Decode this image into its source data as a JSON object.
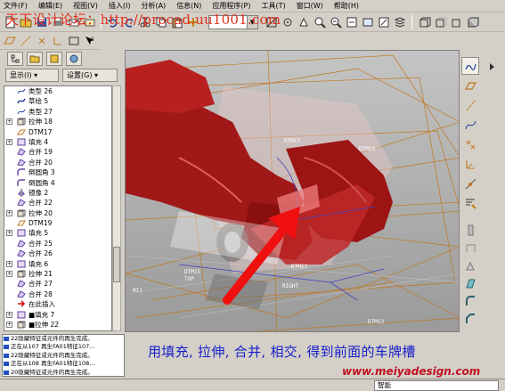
{
  "menu": {
    "items": [
      "文件(F)",
      "编辑(E)",
      "视图(V)",
      "插入(I)",
      "分析(A)",
      "信息(N)",
      "应用程序(P)",
      "工具(T)",
      "窗口(W)",
      "帮助(H)"
    ]
  },
  "watermark": "天下设计论坛：http://procad.uu1001.com",
  "left_panel": {
    "buttons": [
      "显示(I)",
      "设置(G)"
    ],
    "tree_items": [
      {
        "label": "类型 26",
        "icon": "curve-icon"
      },
      {
        "label": "草绘 5",
        "icon": "sketch-icon"
      },
      {
        "label": "类型 27",
        "icon": "curve-icon"
      },
      {
        "label": "拉伸 18",
        "icon": "extrude-icon",
        "expandable": true
      },
      {
        "label": "DTM17",
        "icon": "datum-plane-icon"
      },
      {
        "label": "填充 4",
        "icon": "fill-icon",
        "expandable": true
      },
      {
        "label": "合并 19",
        "icon": "merge-icon"
      },
      {
        "label": "合并 20",
        "icon": "merge-icon"
      },
      {
        "label": "倒圆角 3",
        "icon": "round-icon"
      },
      {
        "label": "倒圆角 4",
        "icon": "round-icon"
      },
      {
        "label": "镜像 2",
        "icon": "mirror-icon"
      },
      {
        "label": "合并 22",
        "icon": "merge-icon"
      },
      {
        "label": "拉伸 20",
        "icon": "extrude-icon",
        "expandable": true
      },
      {
        "label": "DTM19",
        "icon": "datum-plane-icon"
      },
      {
        "label": "填充 5",
        "icon": "fill-icon",
        "expandable": true
      },
      {
        "label": "合并 25",
        "icon": "merge-icon"
      },
      {
        "label": "合并 26",
        "icon": "merge-icon"
      },
      {
        "label": "填充 6",
        "icon": "fill-icon",
        "expandable": true
      },
      {
        "label": "拉伸 21",
        "icon": "extrude-icon",
        "expandable": true
      },
      {
        "label": "合并 27",
        "icon": "merge-icon"
      },
      {
        "label": "合并 28",
        "icon": "merge-icon"
      },
      {
        "label": "在此插入",
        "icon": "insert-here-icon"
      },
      {
        "label": "■填充 7",
        "icon": "fill-icon",
        "expandable": true
      },
      {
        "label": "■拉伸 22",
        "icon": "extrude-icon",
        "expandable": true
      }
    ]
  },
  "viewport": {
    "datum_labels": [
      "DTM17",
      "DTM19",
      "DTM15",
      "DTM11",
      "DTM13",
      "TOP",
      "RIGHT",
      "MI1"
    ]
  },
  "messages": [
    "22隐藏特征或元件的再生完成。",
    "正在从107 再生FA01特征107...",
    "22隐藏特征或元件的再生完成。",
    "正在从108 再生FA01特征108...",
    "20隐藏特征或元件的再生完成。"
  ],
  "caption": "用填充, 拉伸, 合并, 相交, 得到前面的车牌槽",
  "site": "www.meiyadesign.com",
  "status": {
    "filter_value": "智能"
  },
  "colors": {
    "car_red": "#a01818",
    "caption_blue": "#1820c8",
    "site_red": "#c01020",
    "arrow_red": "#f01010",
    "datum_orange": "#c07820"
  }
}
